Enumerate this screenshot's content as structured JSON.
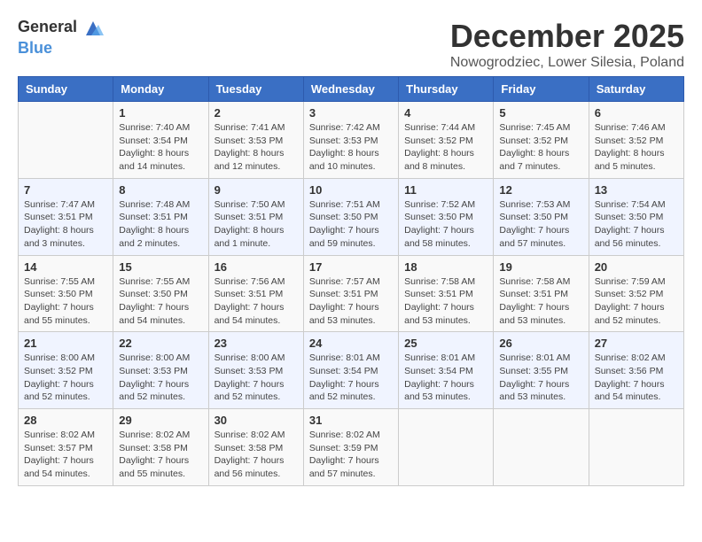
{
  "logo": {
    "general": "General",
    "blue": "Blue"
  },
  "title": "December 2025",
  "location": "Nowogrodziec, Lower Silesia, Poland",
  "weekdays": [
    "Sunday",
    "Monday",
    "Tuesday",
    "Wednesday",
    "Thursday",
    "Friday",
    "Saturday"
  ],
  "weeks": [
    [
      {
        "day": "",
        "sunrise": "",
        "sunset": "",
        "daylight": ""
      },
      {
        "day": "1",
        "sunrise": "Sunrise: 7:40 AM",
        "sunset": "Sunset: 3:54 PM",
        "daylight": "Daylight: 8 hours and 14 minutes."
      },
      {
        "day": "2",
        "sunrise": "Sunrise: 7:41 AM",
        "sunset": "Sunset: 3:53 PM",
        "daylight": "Daylight: 8 hours and 12 minutes."
      },
      {
        "day": "3",
        "sunrise": "Sunrise: 7:42 AM",
        "sunset": "Sunset: 3:53 PM",
        "daylight": "Daylight: 8 hours and 10 minutes."
      },
      {
        "day": "4",
        "sunrise": "Sunrise: 7:44 AM",
        "sunset": "Sunset: 3:52 PM",
        "daylight": "Daylight: 8 hours and 8 minutes."
      },
      {
        "day": "5",
        "sunrise": "Sunrise: 7:45 AM",
        "sunset": "Sunset: 3:52 PM",
        "daylight": "Daylight: 8 hours and 7 minutes."
      },
      {
        "day": "6",
        "sunrise": "Sunrise: 7:46 AM",
        "sunset": "Sunset: 3:52 PM",
        "daylight": "Daylight: 8 hours and 5 minutes."
      }
    ],
    [
      {
        "day": "7",
        "sunrise": "Sunrise: 7:47 AM",
        "sunset": "Sunset: 3:51 PM",
        "daylight": "Daylight: 8 hours and 3 minutes."
      },
      {
        "day": "8",
        "sunrise": "Sunrise: 7:48 AM",
        "sunset": "Sunset: 3:51 PM",
        "daylight": "Daylight: 8 hours and 2 minutes."
      },
      {
        "day": "9",
        "sunrise": "Sunrise: 7:50 AM",
        "sunset": "Sunset: 3:51 PM",
        "daylight": "Daylight: 8 hours and 1 minute."
      },
      {
        "day": "10",
        "sunrise": "Sunrise: 7:51 AM",
        "sunset": "Sunset: 3:50 PM",
        "daylight": "Daylight: 7 hours and 59 minutes."
      },
      {
        "day": "11",
        "sunrise": "Sunrise: 7:52 AM",
        "sunset": "Sunset: 3:50 PM",
        "daylight": "Daylight: 7 hours and 58 minutes."
      },
      {
        "day": "12",
        "sunrise": "Sunrise: 7:53 AM",
        "sunset": "Sunset: 3:50 PM",
        "daylight": "Daylight: 7 hours and 57 minutes."
      },
      {
        "day": "13",
        "sunrise": "Sunrise: 7:54 AM",
        "sunset": "Sunset: 3:50 PM",
        "daylight": "Daylight: 7 hours and 56 minutes."
      }
    ],
    [
      {
        "day": "14",
        "sunrise": "Sunrise: 7:55 AM",
        "sunset": "Sunset: 3:50 PM",
        "daylight": "Daylight: 7 hours and 55 minutes."
      },
      {
        "day": "15",
        "sunrise": "Sunrise: 7:55 AM",
        "sunset": "Sunset: 3:50 PM",
        "daylight": "Daylight: 7 hours and 54 minutes."
      },
      {
        "day": "16",
        "sunrise": "Sunrise: 7:56 AM",
        "sunset": "Sunset: 3:51 PM",
        "daylight": "Daylight: 7 hours and 54 minutes."
      },
      {
        "day": "17",
        "sunrise": "Sunrise: 7:57 AM",
        "sunset": "Sunset: 3:51 PM",
        "daylight": "Daylight: 7 hours and 53 minutes."
      },
      {
        "day": "18",
        "sunrise": "Sunrise: 7:58 AM",
        "sunset": "Sunset: 3:51 PM",
        "daylight": "Daylight: 7 hours and 53 minutes."
      },
      {
        "day": "19",
        "sunrise": "Sunrise: 7:58 AM",
        "sunset": "Sunset: 3:51 PM",
        "daylight": "Daylight: 7 hours and 53 minutes."
      },
      {
        "day": "20",
        "sunrise": "Sunrise: 7:59 AM",
        "sunset": "Sunset: 3:52 PM",
        "daylight": "Daylight: 7 hours and 52 minutes."
      }
    ],
    [
      {
        "day": "21",
        "sunrise": "Sunrise: 8:00 AM",
        "sunset": "Sunset: 3:52 PM",
        "daylight": "Daylight: 7 hours and 52 minutes."
      },
      {
        "day": "22",
        "sunrise": "Sunrise: 8:00 AM",
        "sunset": "Sunset: 3:53 PM",
        "daylight": "Daylight: 7 hours and 52 minutes."
      },
      {
        "day": "23",
        "sunrise": "Sunrise: 8:00 AM",
        "sunset": "Sunset: 3:53 PM",
        "daylight": "Daylight: 7 hours and 52 minutes."
      },
      {
        "day": "24",
        "sunrise": "Sunrise: 8:01 AM",
        "sunset": "Sunset: 3:54 PM",
        "daylight": "Daylight: 7 hours and 52 minutes."
      },
      {
        "day": "25",
        "sunrise": "Sunrise: 8:01 AM",
        "sunset": "Sunset: 3:54 PM",
        "daylight": "Daylight: 7 hours and 53 minutes."
      },
      {
        "day": "26",
        "sunrise": "Sunrise: 8:01 AM",
        "sunset": "Sunset: 3:55 PM",
        "daylight": "Daylight: 7 hours and 53 minutes."
      },
      {
        "day": "27",
        "sunrise": "Sunrise: 8:02 AM",
        "sunset": "Sunset: 3:56 PM",
        "daylight": "Daylight: 7 hours and 54 minutes."
      }
    ],
    [
      {
        "day": "28",
        "sunrise": "Sunrise: 8:02 AM",
        "sunset": "Sunset: 3:57 PM",
        "daylight": "Daylight: 7 hours and 54 minutes."
      },
      {
        "day": "29",
        "sunrise": "Sunrise: 8:02 AM",
        "sunset": "Sunset: 3:58 PM",
        "daylight": "Daylight: 7 hours and 55 minutes."
      },
      {
        "day": "30",
        "sunrise": "Sunrise: 8:02 AM",
        "sunset": "Sunset: 3:58 PM",
        "daylight": "Daylight: 7 hours and 56 minutes."
      },
      {
        "day": "31",
        "sunrise": "Sunrise: 8:02 AM",
        "sunset": "Sunset: 3:59 PM",
        "daylight": "Daylight: 7 hours and 57 minutes."
      },
      {
        "day": "",
        "sunrise": "",
        "sunset": "",
        "daylight": ""
      },
      {
        "day": "",
        "sunrise": "",
        "sunset": "",
        "daylight": ""
      },
      {
        "day": "",
        "sunrise": "",
        "sunset": "",
        "daylight": ""
      }
    ]
  ]
}
